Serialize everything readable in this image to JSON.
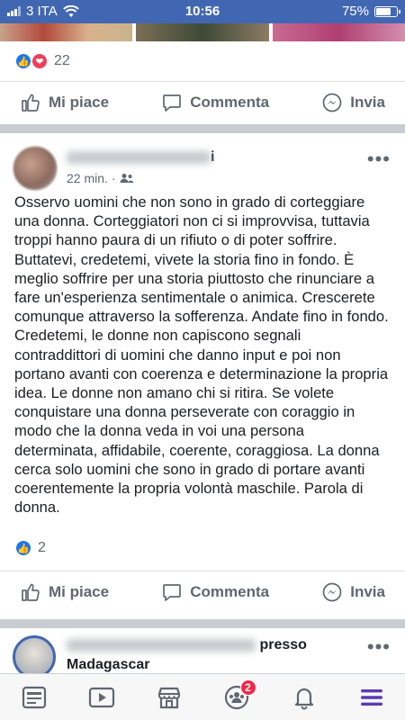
{
  "status_bar": {
    "carrier": "3 ITA",
    "time": "10:56",
    "battery_text": "75%",
    "battery_level": 0.75
  },
  "post1_footer": {
    "reaction_count": "22",
    "like_label": "Mi piace",
    "comment_label": "Commenta",
    "share_label": "Invia"
  },
  "post": {
    "author_suffix": "i",
    "time": "22 min.",
    "text": "Osservo uomini che non sono in grado di corteggiare una donna. Corteggiatori non ci si improvvisa, tuttavia troppi hanno paura di un rifiuto o di poter soffrire. Buttatevi, credetemi, vivete la storia fino in fondo. È meglio soffrire per una storia piuttosto che rinunciare a fare un'esperienza sentimentale o animica. Crescerete comunque attraverso la sofferenza. Andate fino in fondo. Credetemi, le donne non capiscono segnali contraddittori di uomini che danno input e poi non portano avanti con coerenza e determinazione la propria idea. Le donne non amano chi si ritira. Se volete conquistare una donna perseverate con coraggio in modo che la donna veda in voi una persona determinata, affidabile, coerente, coraggiosa. La donna cerca solo uomini che sono in grado di portare avanti coerentemente la propria volontà maschile. Parola di donna.",
    "reaction_count": "2",
    "like_label": "Mi piace",
    "comment_label": "Commenta",
    "share_label": "Invia"
  },
  "next_post": {
    "title_suffix": "presso",
    "subtitle": "Madagascar"
  },
  "tabbar": {
    "groups_badge": "2"
  },
  "colors": {
    "brand": "#4267b2",
    "like": "#1877f2",
    "love": "#f33e58",
    "badge": "#f02849",
    "active_tab": "#5b3ab1"
  }
}
